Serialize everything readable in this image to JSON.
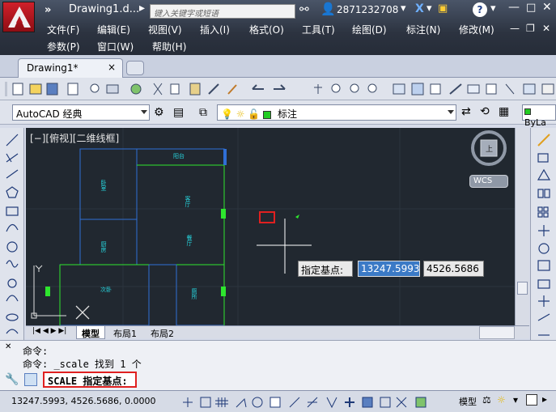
{
  "title_bar": {
    "quick_access_arrow": "»",
    "document_title": "Drawing1.d...",
    "search_placeholder": "键入关键字或短语",
    "user_id": "2871232708",
    "help_label": "?"
  },
  "menu": {
    "row1": [
      "文件(F)",
      "编辑(E)",
      "视图(V)",
      "插入(I)",
      "格式(O)",
      "工具(T)",
      "绘图(D)",
      "标注(N)",
      "修改(M)"
    ],
    "row2": [
      "参数(P)",
      "窗口(W)",
      "帮助(H)"
    ]
  },
  "file_tab": {
    "label": "Drawing1*",
    "close": "×"
  },
  "toolbar": {
    "workspace": "AutoCAD 经典",
    "layer_name": "标注",
    "bylayer": "ByLa"
  },
  "canvas": {
    "viewport_label": "[−][俯视][二维线框]",
    "wcs_label": "WCS",
    "viewcube_label": "上",
    "tooltip_prompt": "指定基点:",
    "tooltip_x": "13247.5993",
    "tooltip_y": "4526.5686",
    "rooms": [
      "阳台",
      "客厅",
      "餐厅",
      "卧室",
      "厨房",
      "次卧",
      "厕所"
    ]
  },
  "layout_tabs": [
    "模型",
    "布局1",
    "布局2"
  ],
  "command": {
    "history": [
      "命令:",
      "命令: _scale 找到 1 个"
    ],
    "input": "SCALE 指定基点:"
  },
  "status": {
    "coordinates": "13247.5993, 4526.5686, 0.0000",
    "model_label": "模型"
  },
  "colors": {
    "canvas_bg": "#212830",
    "wall_blue": "#2f6fd6",
    "wall_green": "#2ee62e",
    "text_cyan": "#27d7e0",
    "highlight_red": "#e02020"
  }
}
